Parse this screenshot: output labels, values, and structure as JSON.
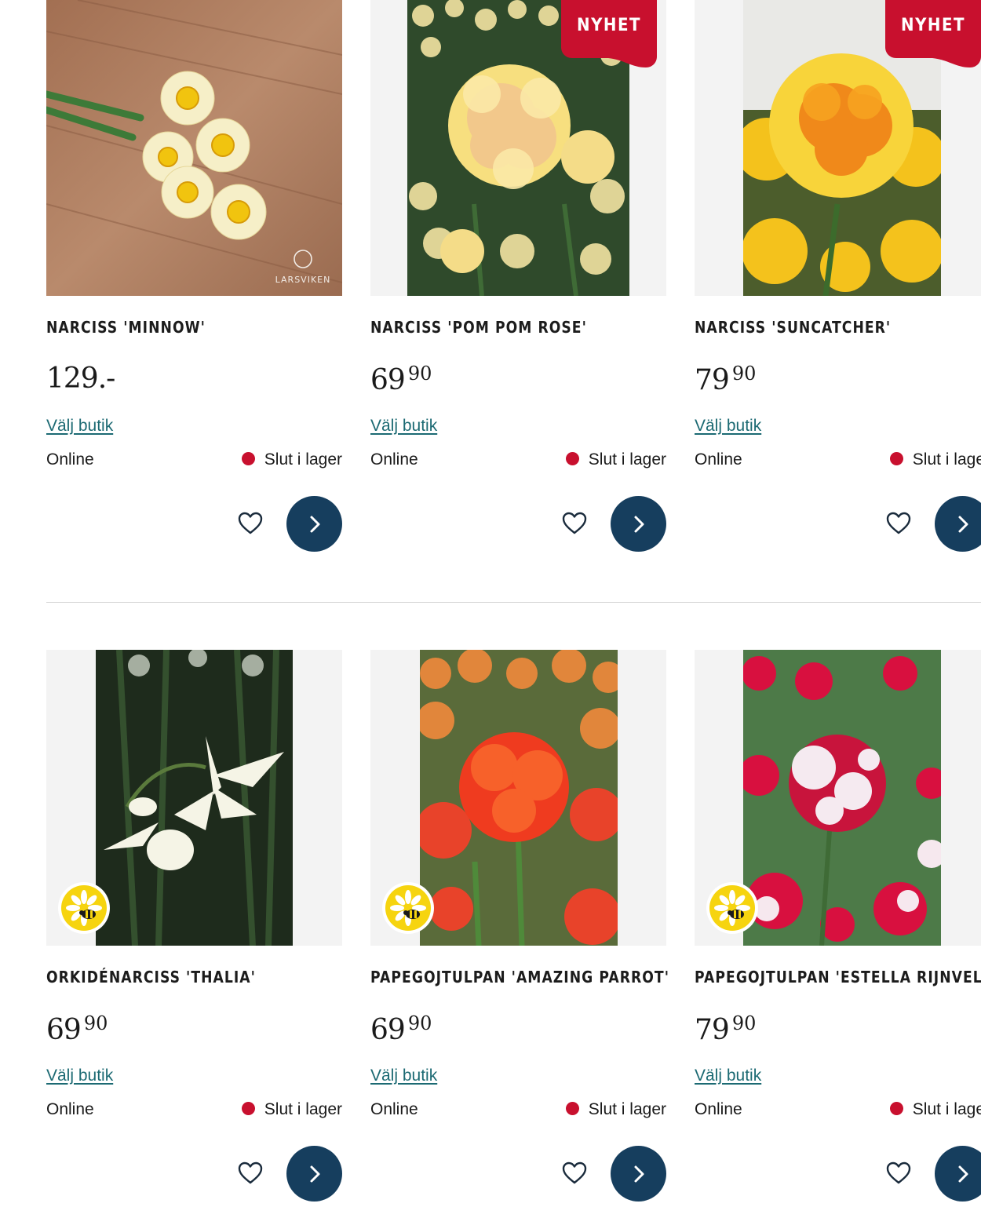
{
  "products": [
    {
      "name": "Narciss 'Minnow'",
      "price_main": "129.-",
      "price_dec": "",
      "badge": "",
      "store_link": "Välj butik",
      "channel": "Online",
      "stock": "Slut i lager",
      "image_watermark": "LARSVIKEN"
    },
    {
      "name": "Narciss 'Pom Pom Rose'",
      "price_main": "69",
      "price_dec": "90",
      "badge": "NYHET",
      "store_link": "Välj butik",
      "channel": "Online",
      "stock": "Slut i lager"
    },
    {
      "name": "Narciss 'Suncatcher'",
      "price_main": "79",
      "price_dec": "90",
      "badge": "NYHET",
      "store_link": "Välj butik",
      "channel": "Online",
      "stock": "Slut i lager"
    },
    {
      "name": "Orkidénarciss 'Thalia'",
      "price_main": "69",
      "price_dec": "90",
      "badge": "",
      "store_link": "Välj butik",
      "channel": "Online",
      "stock": "Slut i lager",
      "bee_badge": "pollinator-icon"
    },
    {
      "name": "Papegojtulpan 'Amazing Parrot'",
      "price_main": "69",
      "price_dec": "90",
      "badge": "",
      "store_link": "Välj butik",
      "channel": "Online",
      "stock": "Slut i lager",
      "bee_badge": "pollinator-icon"
    },
    {
      "name": "Papegojtulpan 'Estella Rijnveld'",
      "price_main": "79",
      "price_dec": "90",
      "badge": "",
      "store_link": "Välj butik",
      "channel": "Online",
      "stock": "Slut i lager",
      "bee_badge": "pollinator-icon"
    }
  ],
  "icons": {
    "favorite": "heart-icon",
    "navigate": "chevron-right-icon",
    "stock_status": "red-dot-icon"
  },
  "colors": {
    "badge_red": "#c8102e",
    "button_navy": "#163e5e",
    "link_teal": "#1c6a73",
    "stock_dot": "#c8102e",
    "bee_yellow": "#f6d40f"
  }
}
